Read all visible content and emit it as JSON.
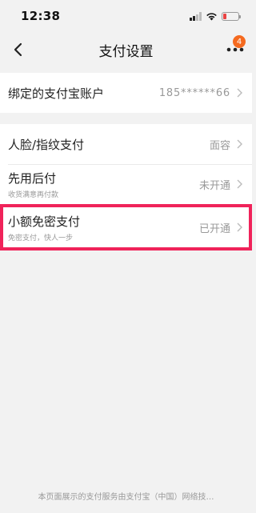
{
  "status_bar": {
    "time": "12:38"
  },
  "nav": {
    "title": "支付设置",
    "badge_count": "4",
    "back_icon": "chevron-left-icon",
    "more_icon": "more-dots-icon"
  },
  "account": {
    "label": "绑定的支付宝账户",
    "value": "185******66"
  },
  "settings": [
    {
      "title": "人脸/指纹支付",
      "subtitle": "",
      "value": "面容"
    },
    {
      "title": "先用后付",
      "subtitle": "收货满意再付款",
      "value": "未开通"
    },
    {
      "title": "小额免密支付",
      "subtitle": "免密支付，快人一步",
      "value": "已开通"
    }
  ],
  "footer": {
    "text": "本页面展示的支付服务由支付宝（中国）网络技…"
  },
  "colors": {
    "badge": "#f56a1f",
    "highlight_border": "#f0235a",
    "background": "#f2f2f2"
  }
}
